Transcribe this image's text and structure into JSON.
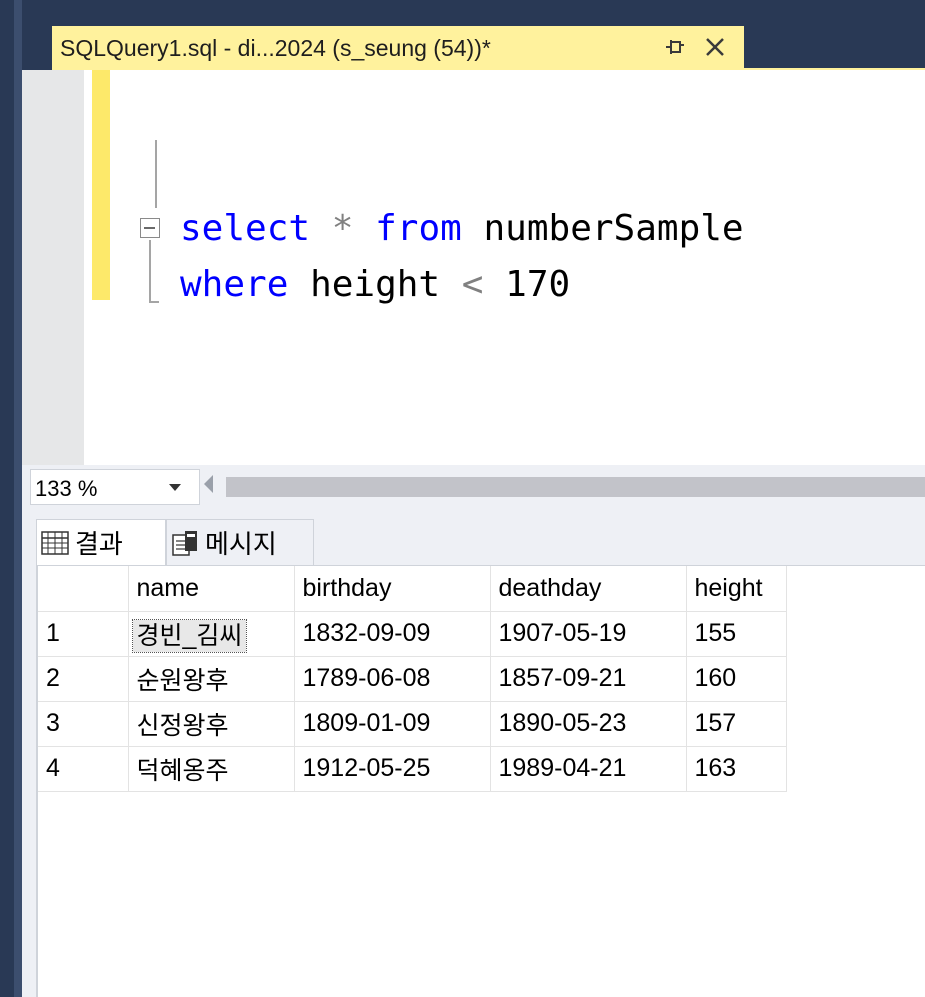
{
  "tab": {
    "title": "SQLQuery1.sql - di...2024 (s_seung (54))*",
    "colors": {
      "active_tab_bg": "#fff29d",
      "strip_bg": "#293955"
    }
  },
  "editor": {
    "line1": {
      "kw1": "select",
      "op": "*",
      "kw2": "from",
      "ident": "numberSample"
    },
    "line2": {
      "kw": "where",
      "ident": "height",
      "op": "<",
      "num": "170"
    },
    "colors": {
      "keyword": "#0000ff",
      "operator": "#808080",
      "identifier": "#000000"
    }
  },
  "zoom": {
    "value": "133 %"
  },
  "results_tabs": {
    "results_label": "결과",
    "messages_label": "메시지",
    "results_icon": "grid-icon",
    "messages_icon": "message-icon"
  },
  "grid": {
    "columns": [
      "",
      "name",
      "birthday",
      "deathday",
      "height"
    ],
    "rows": [
      [
        "1",
        "경빈_김씨",
        "1832-09-09",
        "1907-05-19",
        "155"
      ],
      [
        "2",
        "순원왕후",
        "1789-06-08",
        "1857-09-21",
        "160"
      ],
      [
        "3",
        "신정왕후",
        "1809-01-09",
        "1890-05-23",
        "157"
      ],
      [
        "4",
        "덕혜옹주",
        "1912-05-25",
        "1989-04-21",
        "163"
      ]
    ]
  }
}
